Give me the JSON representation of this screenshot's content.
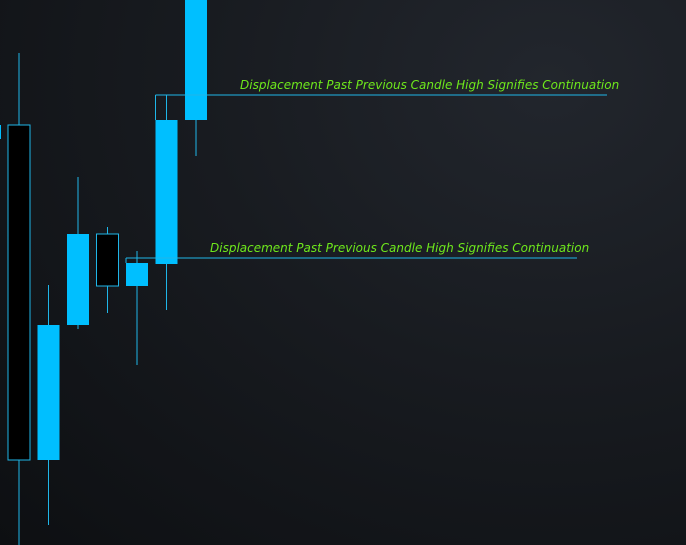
{
  "chart_data": {
    "type": "candlestick",
    "title": "",
    "xlabel": "",
    "ylabel": "",
    "grid": false,
    "legend": "none",
    "ylim": [
      0,
      545
    ],
    "colors": {
      "bullish_fill": "#00bfff",
      "bearish_fill": "#000000",
      "outline": "#1fb6e8",
      "wick": "#1fb6e8",
      "annotation_text": "#6ee81c",
      "annotation_line": "#1fb6e8"
    },
    "candles": [
      {
        "index": 0,
        "open": 420,
        "close": 85,
        "high": 492,
        "low": 0,
        "direction": "bearish"
      },
      {
        "index": 1,
        "open": 85,
        "close": 220,
        "high": 260,
        "low": 20,
        "direction": "bullish"
      },
      {
        "index": 2,
        "open": 220,
        "close": 311,
        "high": 368,
        "low": 216,
        "direction": "bullish"
      },
      {
        "index": 3,
        "open": 311,
        "close": 259,
        "high": 318,
        "low": 232,
        "direction": "bearish"
      },
      {
        "index": 4,
        "open": 259,
        "close": 282,
        "high": 294,
        "low": 180,
        "direction": "bullish"
      },
      {
        "index": 5,
        "open": 281,
        "close": 425,
        "high": 450,
        "low": 235,
        "direction": "bullish"
      },
      {
        "index": 6,
        "open": 425,
        "close": 545,
        "high": 545,
        "low": 389,
        "direction": "bullish"
      }
    ],
    "annotations": [
      {
        "text": "Displacement Past Previous Candle High Signifies Continuation",
        "level": 287,
        "from_candle": 4,
        "label_x": 210
      },
      {
        "text": "Displacement Past Previous Candle High Signifies Continuation",
        "level": 450,
        "from_candle": 5,
        "label_x": 240
      }
    ]
  }
}
